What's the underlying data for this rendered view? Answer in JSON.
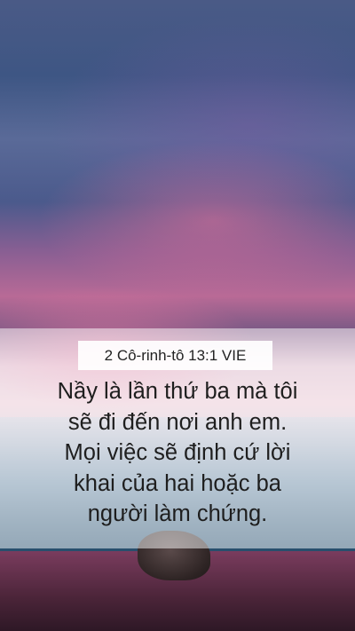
{
  "wallpaper": {
    "reference": "2 Cô-rinh-tô 13:1 VIE",
    "verse_lines": [
      "Nầy là lần thứ ba mà tôi",
      "sẽ đi đến nơi anh em.",
      "Mọi việc sẽ định cứ lời",
      "khai của hai hoặc ba",
      "người làm chứng."
    ]
  },
  "colors": {
    "panel": "#ffffff",
    "text": "#1e1e1e",
    "sky_top": "#4a5a86",
    "sunset_pink": "#e9c7d3"
  }
}
